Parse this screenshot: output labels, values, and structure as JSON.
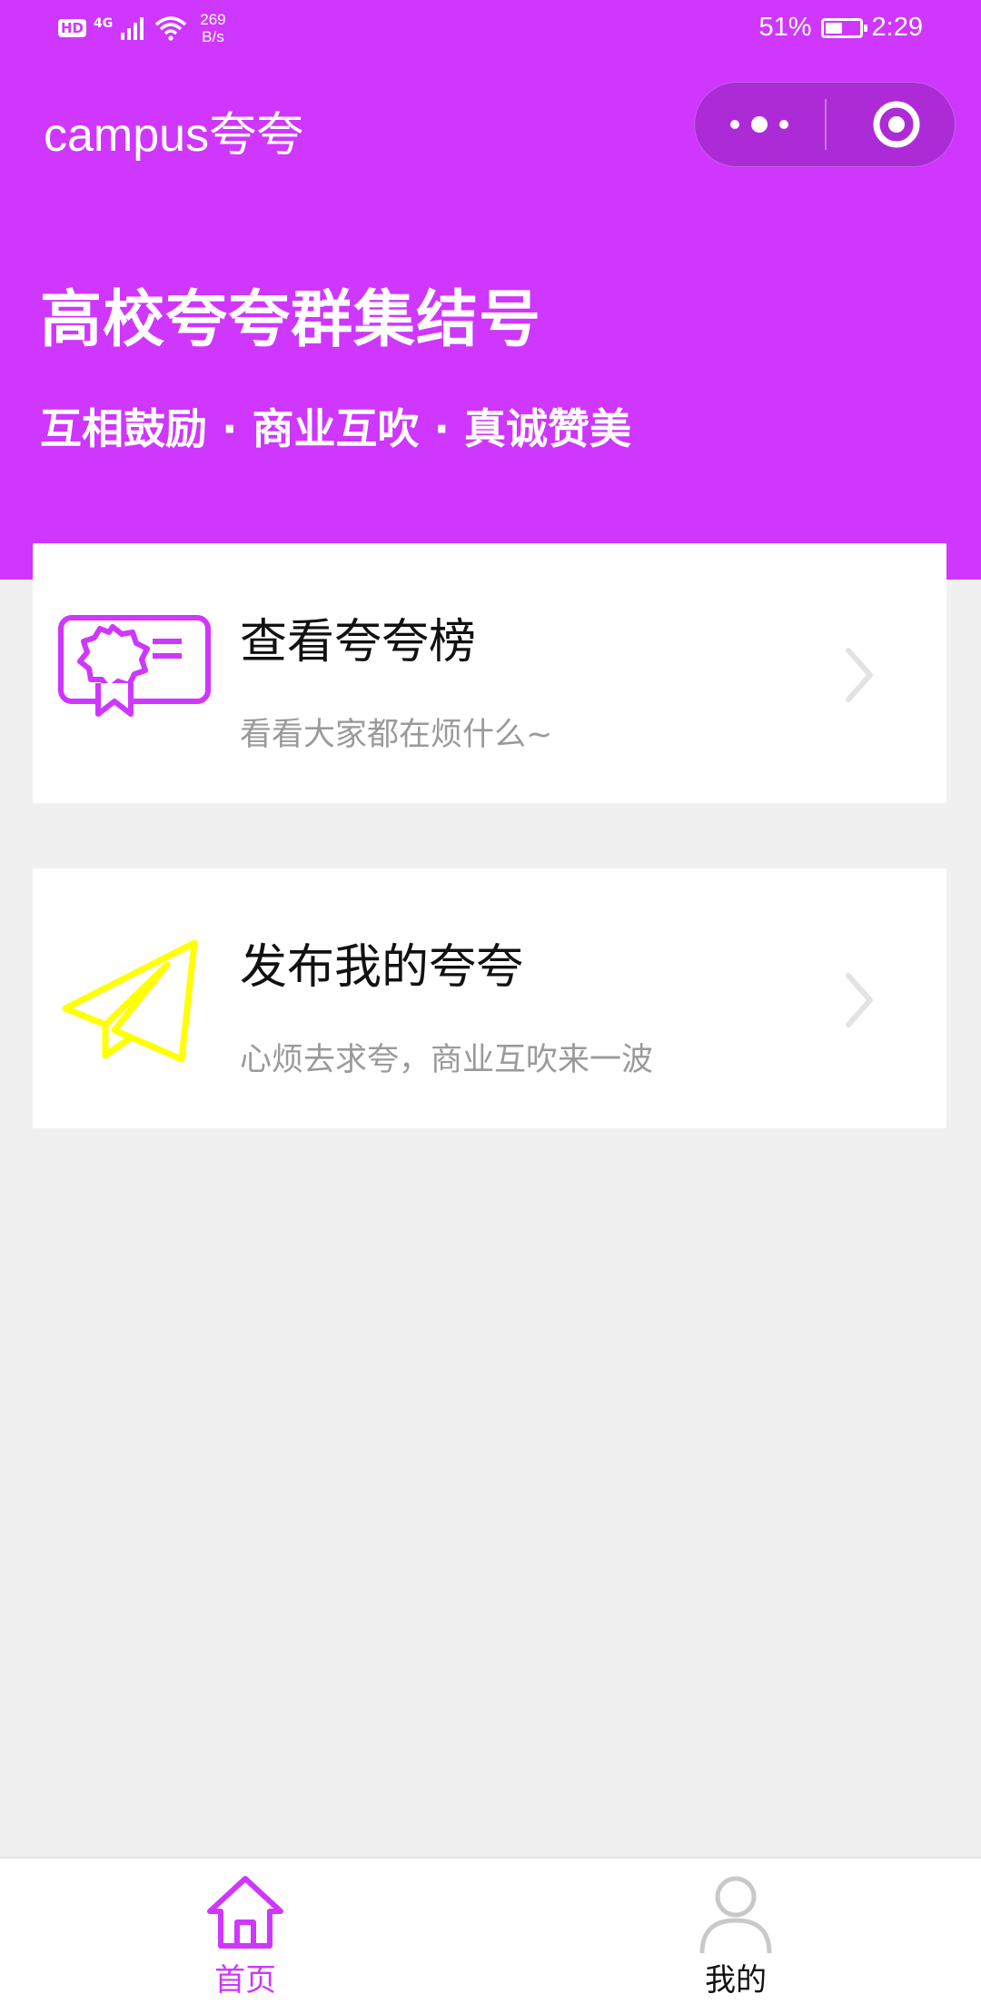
{
  "status_bar": {
    "hd": "HD",
    "network_gen": "4G",
    "speed_value": "269",
    "speed_unit": "B/s",
    "battery_percent": "51%",
    "battery_level": 0.51,
    "time": "2:29"
  },
  "header": {
    "title": "campus夸夸",
    "more_icon": "more-dots-icon",
    "close_icon": "target-close-icon"
  },
  "hero": {
    "title": "高校夸夸群集结号",
    "subtitle": "互相鼓励 · 商业互吹 · 真诚赞美"
  },
  "cards": [
    {
      "title": "查看夸夸榜",
      "desc": "看看大家都在烦什么~",
      "icon": "certificate-icon"
    },
    {
      "title": "发布我的夸夸",
      "desc": "心烦去求夸，商业互吹来一波",
      "icon": "paper-plane-icon"
    }
  ],
  "tabbar": {
    "home_label": "首页",
    "mine_label": "我的"
  },
  "colors": {
    "primary": "#cf36fe",
    "plane": "#ffff00",
    "background": "#f0f0f0",
    "muted_text": "#9a9a9a",
    "chevron": "#e3e3e3"
  }
}
